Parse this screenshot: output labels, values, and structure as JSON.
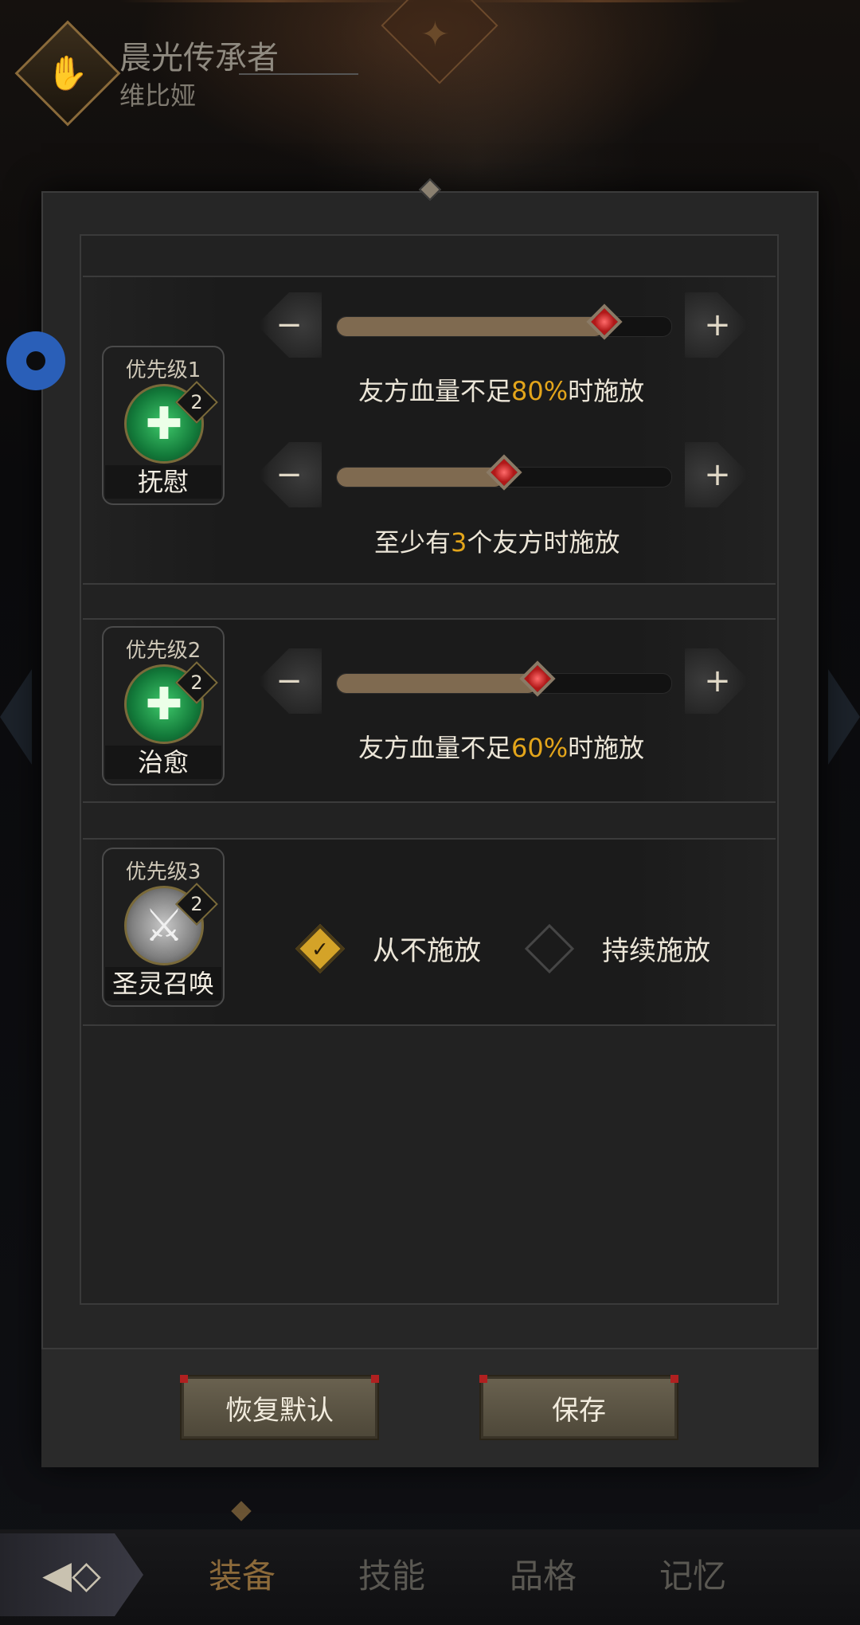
{
  "header": {
    "hero_title": "晨光传承者",
    "hero_name": "维比娅"
  },
  "rules": [
    {
      "priority": "优先级1",
      "skill_name": "抚慰",
      "level": "2",
      "icon": "heal-plus-icon",
      "conditions": [
        {
          "prefix": "友方血量不足",
          "value": "80%",
          "suffix": "时施放",
          "slider_fraction": 0.8
        },
        {
          "prefix": "至少有",
          "value": "3",
          "suffix": "个友方时施放",
          "slider_fraction": 0.5
        }
      ]
    },
    {
      "priority": "优先级2",
      "skill_name": "治愈",
      "level": "2",
      "icon": "heal-burst-icon",
      "conditions": [
        {
          "prefix": "友方血量不足",
          "value": "60%",
          "suffix": "时施放",
          "slider_fraction": 0.6
        }
      ]
    },
    {
      "priority": "优先级3",
      "skill_name": "圣灵召唤",
      "level": "2",
      "icon": "holy-summon-icon",
      "options": [
        {
          "label": "从不施放",
          "selected": true
        },
        {
          "label": "持续施放",
          "selected": false
        }
      ]
    }
  ],
  "buttons": {
    "minus": "−",
    "plus": "+",
    "reset": "恢复默认",
    "save": "保存"
  },
  "nav": {
    "back_icon": "◀◇",
    "tabs": [
      "装备",
      "技能",
      "品格",
      "记忆"
    ],
    "active_tab": "装备"
  },
  "colors": {
    "highlight": "#e3a51b",
    "panel_bg": "#262626",
    "selected_option": "#d4a328",
    "slider_fill": "#7f6a50"
  }
}
